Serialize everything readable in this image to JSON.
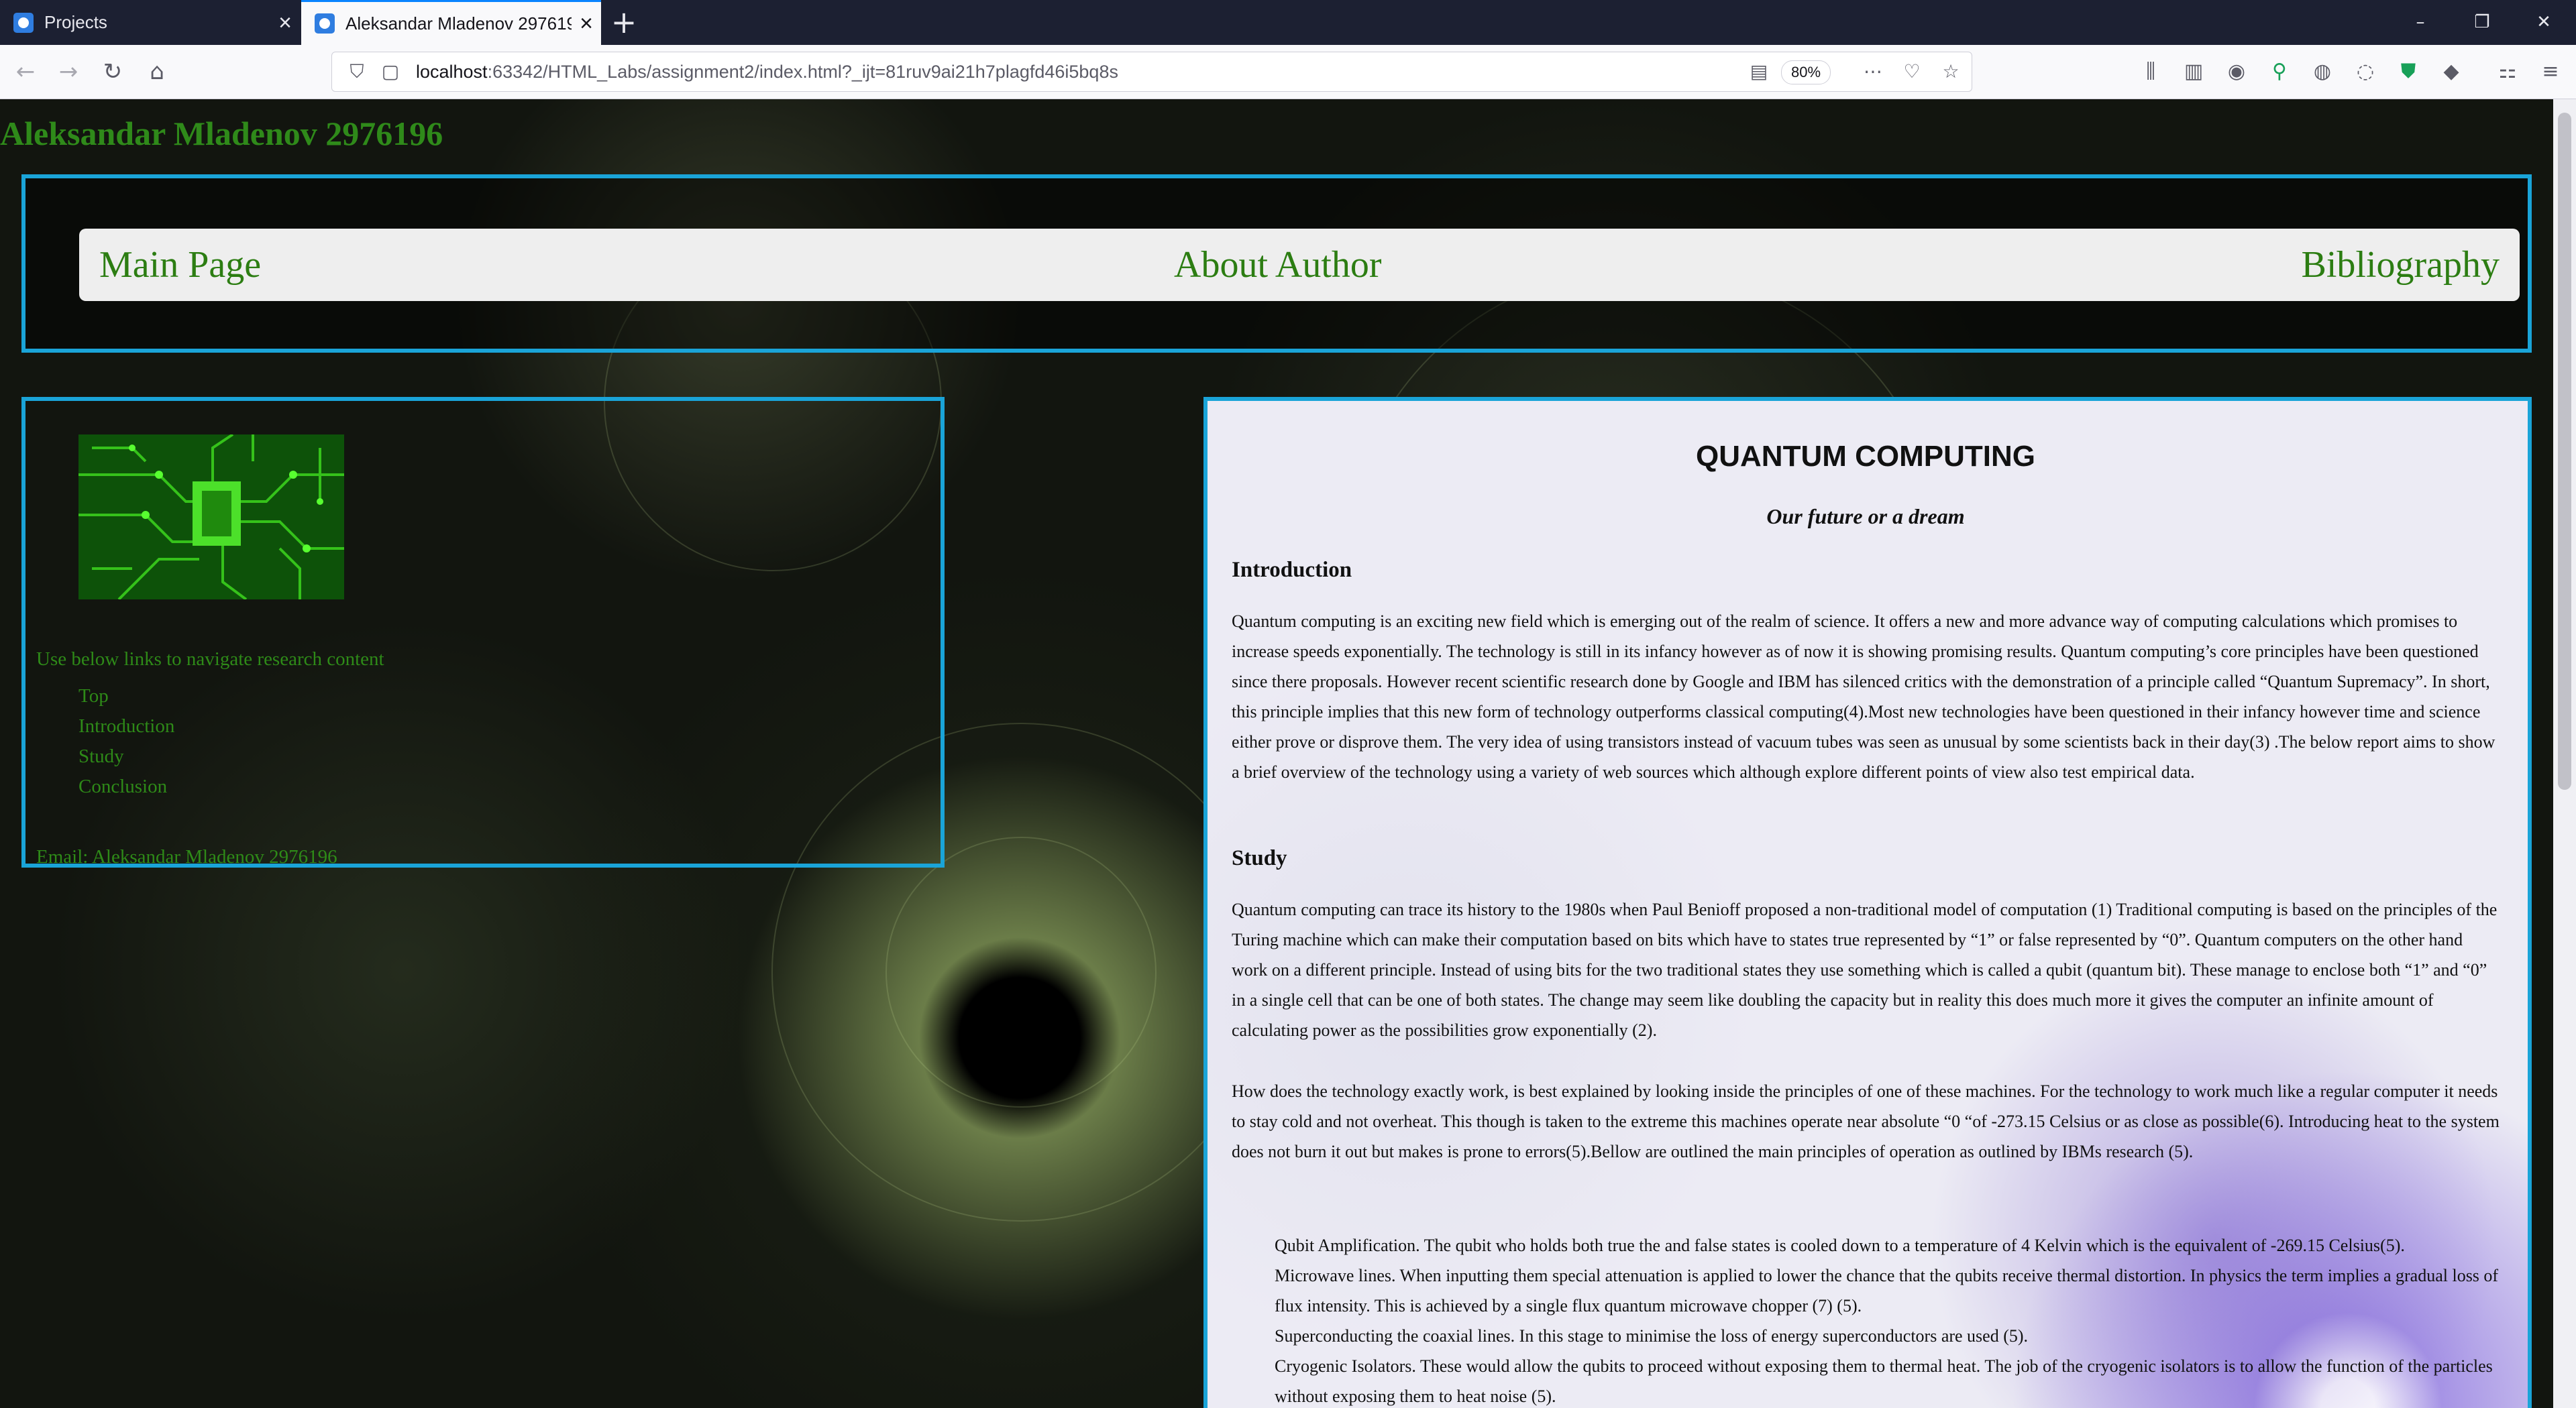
{
  "browser": {
    "tabs": [
      {
        "label": "Projects",
        "active": false
      },
      {
        "label": "Aleksandar Mladenov 2976196",
        "active": true
      }
    ],
    "url_host": "localhost",
    "url_rest": ":63342/HTML_Labs/assignment2/index.html?_ijt=81ruv9ai21h7plagfd46i5bq8s",
    "zoom": "80%",
    "accent": "#0a84ff"
  },
  "site": {
    "title": "Aleksandar Mladenov 2976196",
    "menu": [
      "Main Page",
      "About Author",
      "Bibliography"
    ],
    "accent_border": "#1aa4d8",
    "text_green": "#2e8a18"
  },
  "sidebar": {
    "image_icon": "circuit-board-image",
    "hint": "Use below links to navigate research content",
    "links": [
      "Top",
      "Introduction",
      "Study",
      "Conclusion"
    ],
    "email": "Email: Aleksandar Mladenov 2976196"
  },
  "article": {
    "title": "QUANTUM COMPUTING",
    "subtitle": "Our future or a dream",
    "intro_heading": "Introduction",
    "intro_text": "Quantum computing is an exciting new field which is emerging out of the realm of science. It offers a new and more advance way of computing calculations which promises to increase speeds exponentially. The technology is still in its infancy however as of now it is showing promising results. Quantum computing’s core principles have been questioned since there proposals. However recent scientific research done by Google and IBM has silenced critics with the demonstration of a principle called “Quantum Supremacy”. In short, this principle implies that this new form of technology outperforms classical computing(4).Most new technologies have been questioned in their infancy however time and science either prove or disprove them. The very idea of using transistors instead of vacuum tubes was seen as unusual by some scientists back in their day(3) .The below report aims to show a brief overview of the technology using a variety of web sources which although explore different points of view also test empirical data.",
    "study_heading": "Study",
    "study_text_1": "Quantum computing can trace its history to the 1980s when Paul Benioff proposed a non-traditional model of computation (1) Traditional computing is based on the principles of the Turing machine which can make their computation based on bits which have to states true represented by “1” or false represented by “0”. Quantum computers on the other hand work on a different principle. Instead of using bits for the two traditional states they use something which is called a qubit (quantum bit). These manage to enclose both “1” and “0” in a single cell that can be one of both states. The change may seem like doubling the capacity but in reality this does much more it gives the computer an infinite amount of calculating power as the possibilities grow exponentially (2).",
    "study_text_2": "How does the technology exactly work, is best explained by looking inside the principles of one of these machines. For the technology to work much like a regular computer it needs to stay cold and not overheat. This though is taken to the extreme this machines operate near absolute “0 “of -273.15 Celsius or as close as possible(6). Introducing heat to the system does not burn it out but makes is prone to errors(5).Bellow are outlined the main principles of operation as outlined by IBMs research (5).",
    "items": [
      "Qubit Amplification. The qubit who holds both true the and false states is cooled down to a temperature of 4 Kelvin which is the equivalent of -269.15 Celsius(5).",
      "Microwave lines. When inputting them special attenuation is applied to lower the chance that the qubits receive thermal distortion. In physics the term implies a gradual loss of flux intensity. This is achieved by a single flux quantum microwave chopper (7) (5).",
      "Superconducting the coaxial lines. In this stage to minimise the loss of energy superconductors are used (5).",
      "Cryogenic Isolators. These would allow the qubits to proceed without exposing them to thermal heat. The job of the cryogenic isolators is to allow the function of the particles without exposing them to heat noise (5)."
    ]
  }
}
